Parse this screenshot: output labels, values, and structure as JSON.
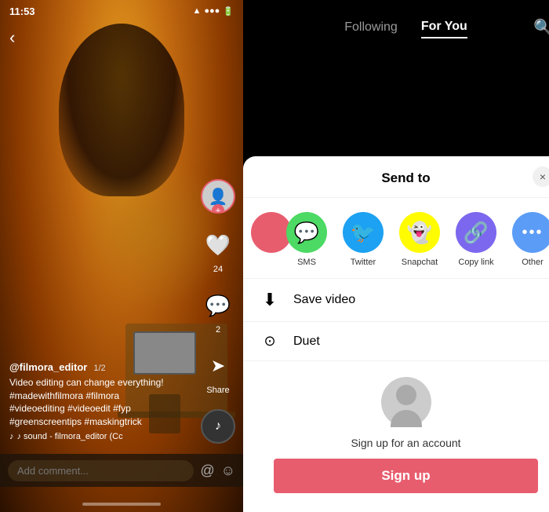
{
  "phone": {
    "time": "11:53",
    "username": "@filmora_editor",
    "date": "1/2",
    "caption": "Video editing can change everything!\n#madewithfilmora #filmora\n#videoediting #videoedit #fyp\n#greenscreentips #maskingtrick",
    "music": "♪ sound - filmora_editor (Cc",
    "comment_placeholder": "Add comment...",
    "likes": "24",
    "comments": "2",
    "share_label": "Share"
  },
  "nav": {
    "following_label": "Following",
    "foryou_label": "For You",
    "active_tab": "foryou"
  },
  "sheet": {
    "title": "Send to",
    "close_label": "×",
    "share_items": [
      {
        "id": "sms",
        "label": "SMS",
        "icon": "💬",
        "color_class": "sms"
      },
      {
        "id": "twitter",
        "label": "Twitter",
        "icon": "🐦",
        "color_class": "twitter"
      },
      {
        "id": "snapchat",
        "label": "Snapchat",
        "icon": "👻",
        "color_class": "snapchat"
      },
      {
        "id": "copylink",
        "label": "Copy link",
        "icon": "🔗",
        "color_class": "copylink"
      },
      {
        "id": "other",
        "label": "Other",
        "icon": "···",
        "color_class": "other"
      }
    ],
    "save_video_label": "Save video",
    "duet_label": "Duet",
    "signup_text": "Sign up for an account",
    "signup_btn_label": "Sign up"
  }
}
